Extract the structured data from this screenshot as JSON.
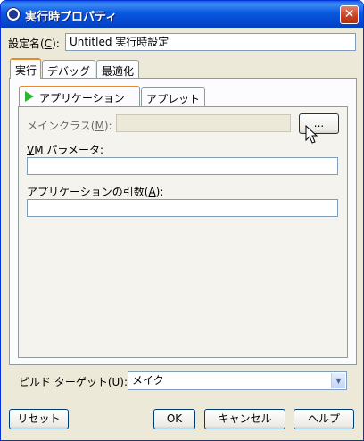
{
  "window": {
    "title": "実行時プロパティ",
    "close_glyph": "✕"
  },
  "settings_name": {
    "label": "設定名(",
    "mnemonic": "C",
    "label_end": "):",
    "value": "Untitled 実行時設定"
  },
  "tabs": [
    {
      "label": "実行"
    },
    {
      "label": "デバッグ"
    },
    {
      "label": "最適化"
    }
  ],
  "subtabs": [
    {
      "label": "アプリケーション"
    },
    {
      "label": "アプレット"
    }
  ],
  "main_class": {
    "label": "メインクラス(",
    "mnemonic": "M",
    "label_end": "):",
    "value": "",
    "browse_label": "..."
  },
  "vm_params": {
    "label_mnemonic": "V",
    "label_rest": "M パラメータ:",
    "value": ""
  },
  "app_args": {
    "label": "アプリケーションの引数(",
    "mnemonic": "A",
    "label_end": "):",
    "value": ""
  },
  "build_target": {
    "label": "ビルド ターゲット(",
    "mnemonic": "U",
    "label_end": "):",
    "value": "メイク"
  },
  "buttons": {
    "reset": "リセット",
    "ok": "OK",
    "cancel": "キャンセル",
    "help": "ヘルプ"
  },
  "colors": {
    "titlebar": "#0a58e0",
    "face": "#ece9d8",
    "play_icon": "#2fb52f"
  }
}
